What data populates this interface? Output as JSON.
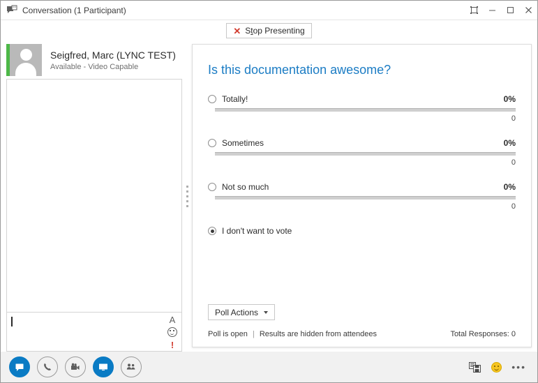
{
  "window": {
    "title": "Conversation (1 Participant)",
    "title_icon": "conversation-icon",
    "controls": {
      "popout_label": "Pop out",
      "minimize_label": "Minimize",
      "maximize_label": "Maximize",
      "close_label": "Close"
    }
  },
  "present_bar": {
    "stop_label_before": "S",
    "stop_label_accel": "t",
    "stop_label_after": "op Presenting",
    "stop_icon": "red-x-icon"
  },
  "participant": {
    "name": "Seigfred, Marc (LYNC TEST)",
    "status": "Available - Video Capable",
    "presence_color": "#4db848",
    "avatar_icon": "person-avatar-icon"
  },
  "compose": {
    "value": "",
    "tools": [
      {
        "name": "font-icon",
        "glyph": "A"
      },
      {
        "name": "emoticon-icon",
        "glyph": ""
      },
      {
        "name": "high-importance-icon",
        "glyph": "!"
      }
    ]
  },
  "poll": {
    "title": "Is this documentation awesome?",
    "title_color": "#1b7cc4",
    "options": [
      {
        "label": "Totally!",
        "percent": "0%",
        "percent_value": 0,
        "count": "0",
        "selected": false,
        "has_bar": true
      },
      {
        "label": "Sometimes",
        "percent": "0%",
        "percent_value": 0,
        "count": "0",
        "selected": false,
        "has_bar": true
      },
      {
        "label": "Not so much",
        "percent": "0%",
        "percent_value": 0,
        "count": "0",
        "selected": false,
        "has_bar": true
      },
      {
        "label": "I don't want to vote",
        "percent": "",
        "percent_value": null,
        "count": "",
        "selected": true,
        "has_bar": false
      }
    ],
    "actions_button": "Poll Actions",
    "status_open": "Poll is open",
    "status_separator": "|",
    "status_visibility": "Results are hidden from attendees",
    "total_responses": "Total Responses: 0"
  },
  "toolbar": {
    "buttons": [
      {
        "name": "im-button",
        "icon": "chat-bubble-icon",
        "state": "active"
      },
      {
        "name": "call-button",
        "icon": "phone-icon",
        "state": "inactive"
      },
      {
        "name": "video-button",
        "icon": "video-camera-icon",
        "state": "inactive"
      },
      {
        "name": "present-button",
        "icon": "monitor-icon",
        "state": "active"
      },
      {
        "name": "participants-button",
        "icon": "people-icon",
        "state": "inactive"
      }
    ],
    "right_tools": [
      {
        "name": "save-im-icon"
      },
      {
        "name": "emoji-icon"
      },
      {
        "name": "more-options-icon",
        "glyph": "•••"
      }
    ]
  }
}
